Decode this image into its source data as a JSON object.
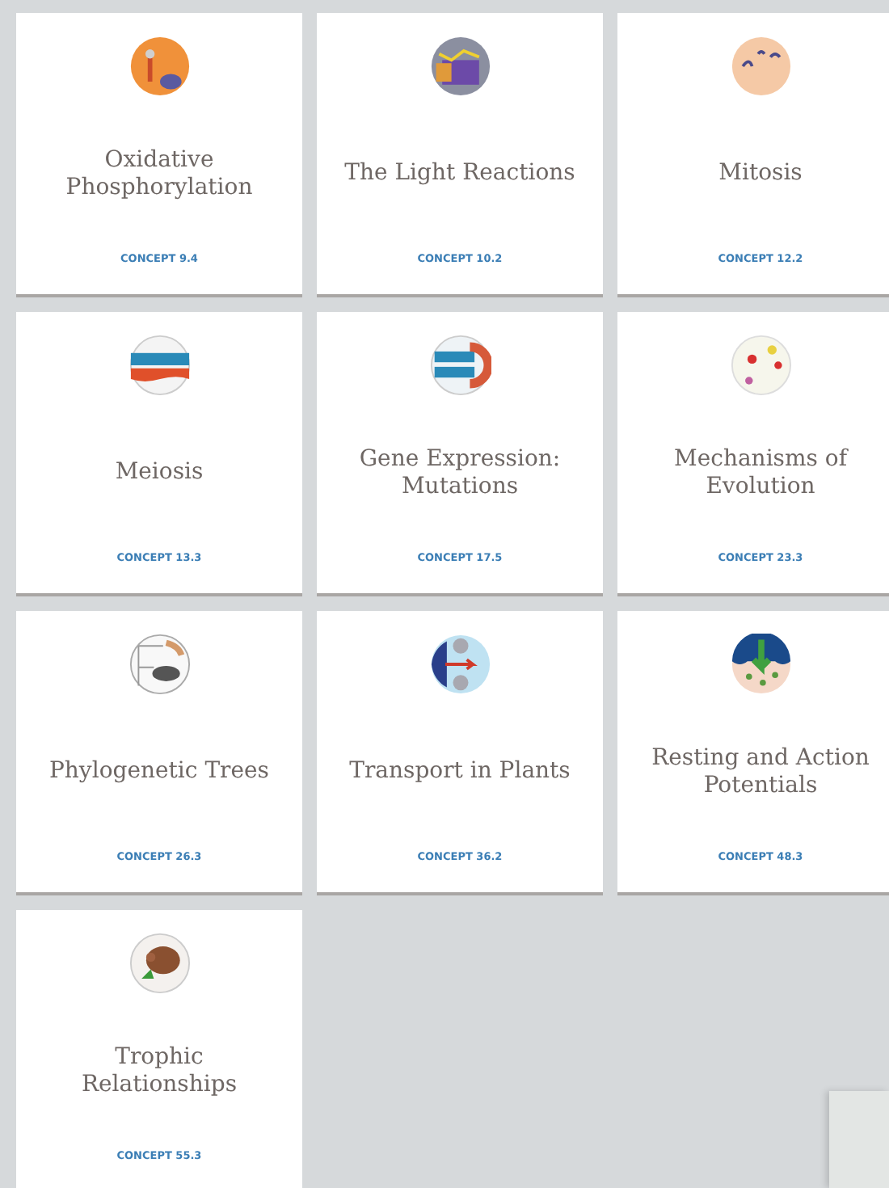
{
  "cards": [
    {
      "title": "Oxidative Phosphorylation",
      "concept": "CONCEPT 9.4"
    },
    {
      "title": "The Light Reactions",
      "concept": "CONCEPT 10.2"
    },
    {
      "title": "Mitosis",
      "concept": "CONCEPT 12.2"
    },
    {
      "title": "Meiosis",
      "concept": "CONCEPT 13.3"
    },
    {
      "title": "Gene Expression: Mutations",
      "concept": "CONCEPT 17.5"
    },
    {
      "title": "Mechanisms of Evolution",
      "concept": "CONCEPT 23.3"
    },
    {
      "title": "Phylogenetic Trees",
      "concept": "CONCEPT 26.3"
    },
    {
      "title": "Transport in Plants",
      "concept": "CONCEPT 36.2"
    },
    {
      "title": "Resting and Action Potentials",
      "concept": "CONCEPT 48.3"
    },
    {
      "title": "Trophic Relationships",
      "concept": "CONCEPT 55.3"
    }
  ]
}
